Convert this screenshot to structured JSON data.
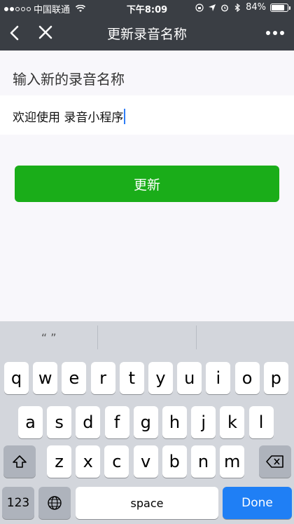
{
  "status_bar": {
    "carrier": "中国联通",
    "time": "下午8:09",
    "battery": "84%",
    "battery_level": 0.84
  },
  "navbar": {
    "title": "更新录音名称",
    "icons": [
      "chevron-left-icon",
      "close-icon",
      "more-icon"
    ]
  },
  "form": {
    "label": "输入新的录音名称",
    "input_value": "欢迎使用 录音小程序",
    "button_label": "更新"
  },
  "keyboard": {
    "suggestion": "“ ”",
    "rows": [
      [
        "q",
        "w",
        "e",
        "r",
        "t",
        "y",
        "u",
        "i",
        "o",
        "p"
      ],
      [
        "a",
        "s",
        "d",
        "f",
        "g",
        "h",
        "j",
        "k",
        "l"
      ],
      [
        "z",
        "x",
        "c",
        "v",
        "b",
        "n",
        "m"
      ]
    ],
    "numbers_key": "123",
    "space_key": "space",
    "done_key": "Done"
  },
  "colors": {
    "nav_bg": "#3a3e44",
    "primary": "#1aad19",
    "done": "#1f7ff5",
    "caret": "#2f7df6"
  }
}
